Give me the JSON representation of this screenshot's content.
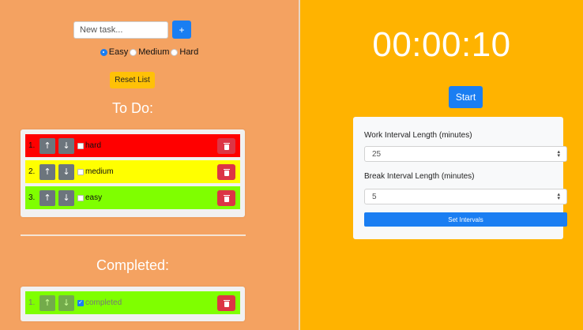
{
  "colors": {
    "left_bg": "#f4a261",
    "right_bg": "#ffb300",
    "primary": "#1a7ef2",
    "danger": "#dc3545",
    "warning": "#ffc107",
    "hard": "#ff0000",
    "medium": "#ffff00",
    "easy": "#7fff00"
  },
  "new_task": {
    "placeholder": "New task...",
    "add_label": "+"
  },
  "difficulty": {
    "options": [
      "Easy",
      "Medium",
      "Hard"
    ],
    "selected": "Easy"
  },
  "reset_label": "Reset List",
  "todo": {
    "heading": "To Do:",
    "tasks": [
      {
        "num": "1.",
        "label": "hard",
        "difficulty": "hard",
        "checked": false
      },
      {
        "num": "2.",
        "label": "medium",
        "difficulty": "medium",
        "checked": false
      },
      {
        "num": "3.",
        "label": "easy",
        "difficulty": "easy",
        "checked": false
      }
    ]
  },
  "completed": {
    "heading": "Completed:",
    "tasks": [
      {
        "num": "1.",
        "label": "completed",
        "difficulty": "easy",
        "checked": true
      }
    ]
  },
  "icons": {
    "up": "↑",
    "down": "↓",
    "delete": "trash-icon"
  },
  "timer": {
    "display": "00:00:10",
    "start_label": "Start"
  },
  "settings": {
    "work_label": "Work Interval Length (minutes)",
    "work_value": "25",
    "break_label": "Break Interval Length (minutes)",
    "break_value": "5",
    "set_label": "Set Intervals"
  }
}
